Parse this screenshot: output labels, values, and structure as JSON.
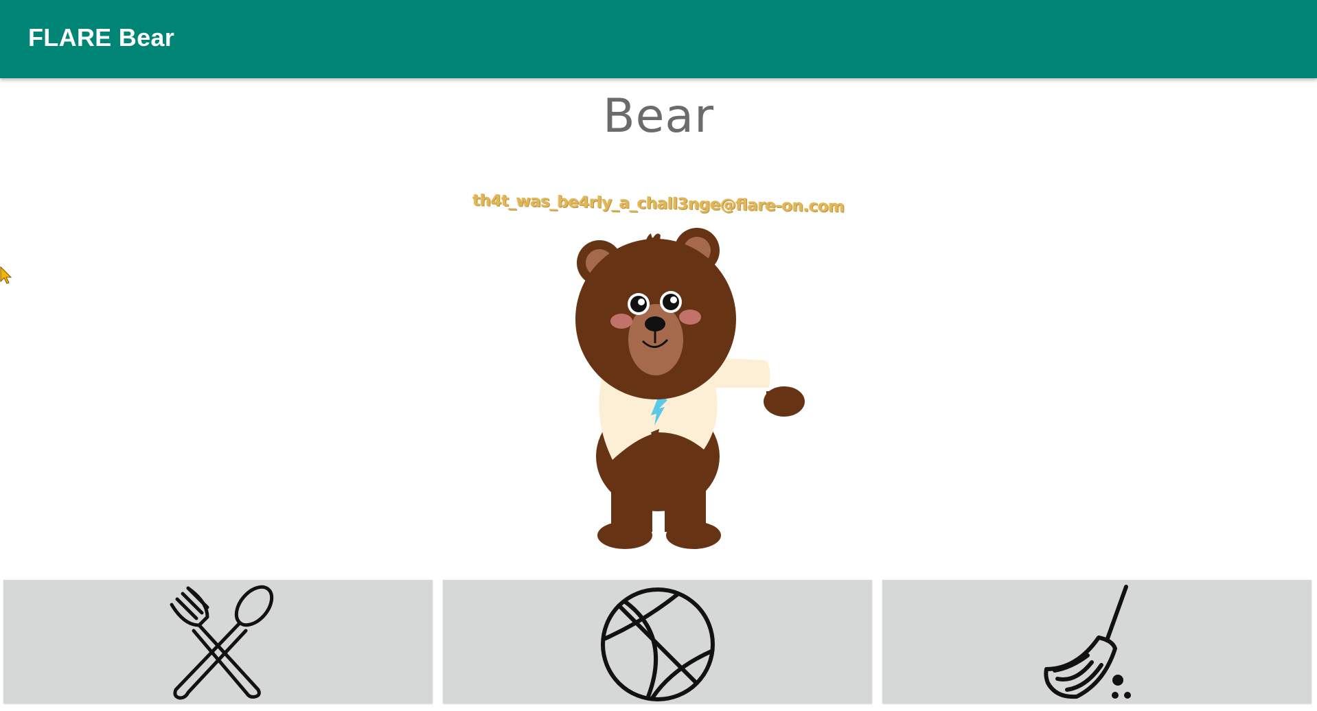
{
  "app_bar": {
    "title": "FLARE Bear",
    "color": "#018577"
  },
  "main": {
    "heading": "Bear",
    "flag_text": "th4t_was_be4rly_a_chall3nge@flare-on.com",
    "flag_color": "#e0b65a",
    "bear_image": "bear-wearing-shirt-icon"
  },
  "actions": [
    {
      "name": "eat",
      "icon": "fork-and-spoon-icon"
    },
    {
      "name": "play",
      "icon": "basketball-icon"
    },
    {
      "name": "clean",
      "icon": "broom-icon"
    }
  ],
  "colors": {
    "button_bg": "#d6d7d7",
    "bear_brown": "#663315",
    "shirt": "#fdefd6",
    "logo_blue": "#5bc8e8"
  }
}
